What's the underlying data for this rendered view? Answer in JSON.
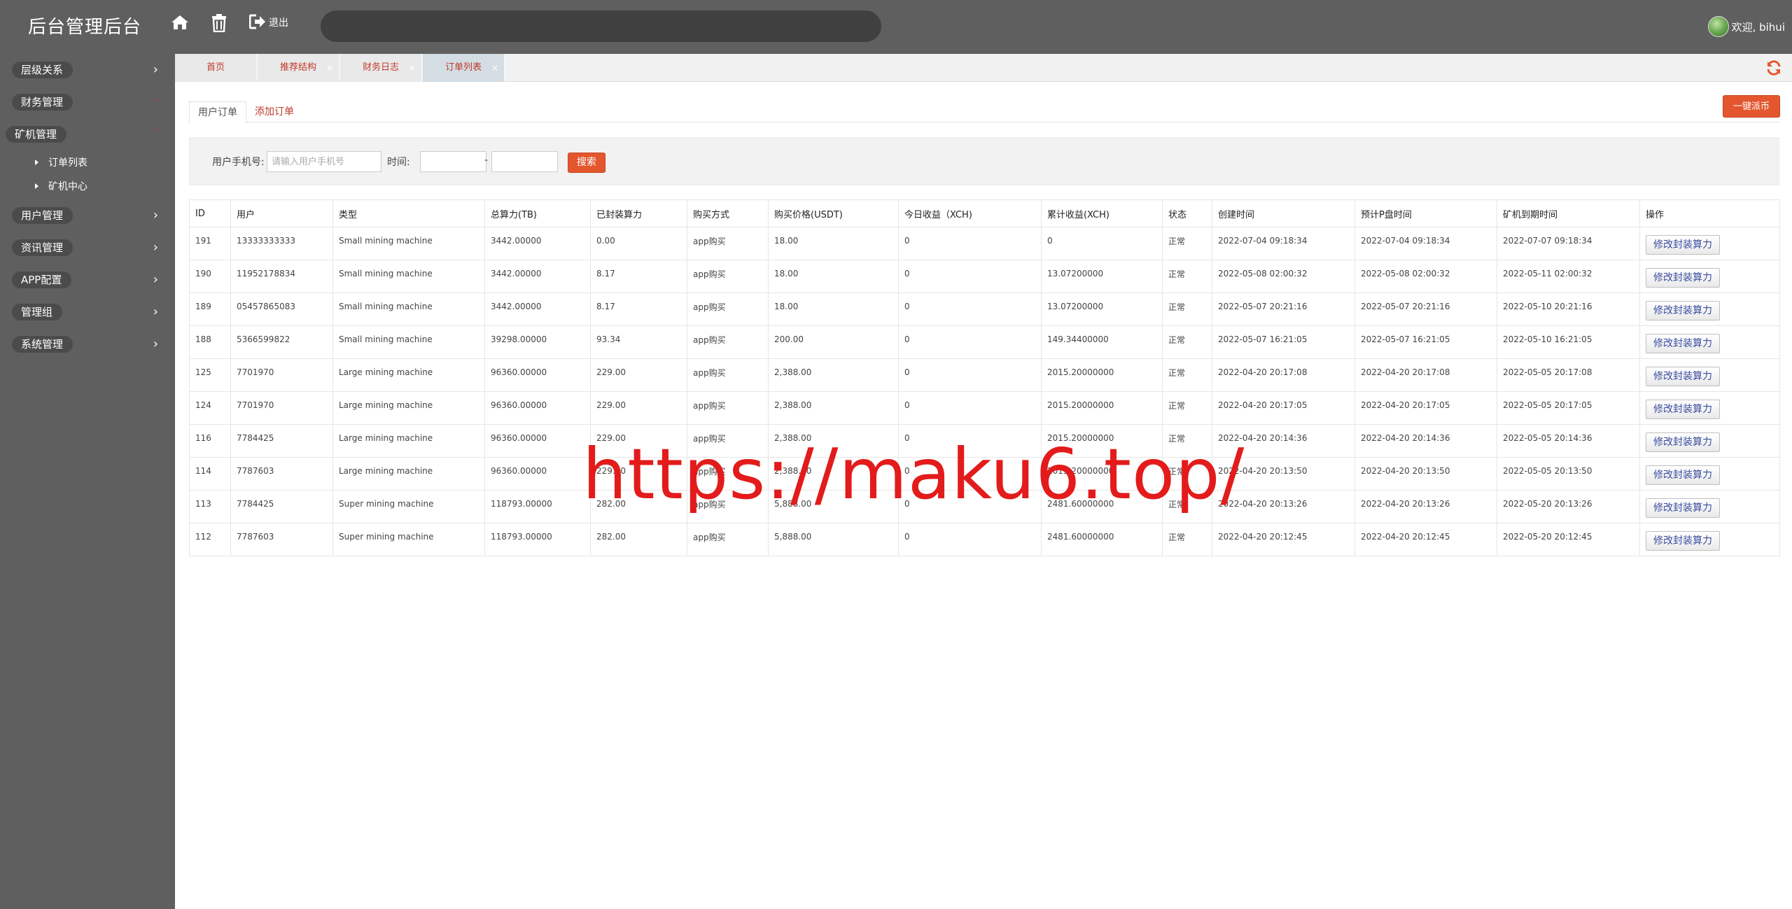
{
  "app": {
    "title": "后台管理后台"
  },
  "header": {
    "logout_label": "退出",
    "search_placeholder": "",
    "welcome": "欢迎, bihui"
  },
  "sidebar": {
    "items": [
      {
        "label": "层级关系"
      },
      {
        "label": "财务管理"
      },
      {
        "label": "矿机管理",
        "children": [
          {
            "label": "订单列表"
          },
          {
            "label": "矿机中心"
          }
        ]
      },
      {
        "label": "用户管理"
      },
      {
        "label": "资讯管理"
      },
      {
        "label": "APP配置"
      },
      {
        "label": "管理组"
      },
      {
        "label": "系统管理"
      }
    ]
  },
  "tabs": [
    {
      "label": "首页"
    },
    {
      "label": "推荐结构"
    },
    {
      "label": "财务日志"
    },
    {
      "label": "订单列表"
    }
  ],
  "subtabs": {
    "active": "用户订单",
    "link": "添加订单"
  },
  "onekey_button": "一键派币",
  "filter": {
    "phone_label": "用户手机号:",
    "phone_placeholder": "请输入用户手机号",
    "time_label": "时间:",
    "range_sep": "-",
    "search_button": "搜索"
  },
  "table": {
    "headers": [
      "ID",
      "用户",
      "类型",
      "总算力(TB)",
      "已封装算力",
      "购买方式",
      "购买价格(USDT)",
      "今日收益（XCH)",
      "累计收益(XCH)",
      "状态",
      "创建时间",
      "预计P盘时间",
      "矿机到期时间",
      "操作"
    ],
    "action_label": "修改封装算力",
    "rows": [
      [
        "191",
        "13333333333",
        "Small mining machine",
        "3442.00000",
        "0.00",
        "app购买",
        "18.00",
        "0",
        "0",
        "正常",
        "2022-07-04 09:18:34",
        "2022-07-04 09:18:34",
        "2022-07-07 09:18:34"
      ],
      [
        "190",
        "11952178834",
        "Small mining machine",
        "3442.00000",
        "8.17",
        "app购买",
        "18.00",
        "0",
        "13.07200000",
        "正常",
        "2022-05-08 02:00:32",
        "2022-05-08 02:00:32",
        "2022-05-11 02:00:32"
      ],
      [
        "189",
        "05457865083",
        "Small mining machine",
        "3442.00000",
        "8.17",
        "app购买",
        "18.00",
        "0",
        "13.07200000",
        "正常",
        "2022-05-07 20:21:16",
        "2022-05-07 20:21:16",
        "2022-05-10 20:21:16"
      ],
      [
        "188",
        "5366599822",
        "Small mining machine",
        "39298.00000",
        "93.34",
        "app购买",
        "200.00",
        "0",
        "149.34400000",
        "正常",
        "2022-05-07 16:21:05",
        "2022-05-07 16:21:05",
        "2022-05-10 16:21:05"
      ],
      [
        "125",
        "7701970",
        "Large mining machine",
        "96360.00000",
        "229.00",
        "app购买",
        "2,388.00",
        "0",
        "2015.20000000",
        "正常",
        "2022-04-20 20:17:08",
        "2022-04-20 20:17:08",
        "2022-05-05 20:17:08"
      ],
      [
        "124",
        "7701970",
        "Large mining machine",
        "96360.00000",
        "229.00",
        "app购买",
        "2,388.00",
        "0",
        "2015.20000000",
        "正常",
        "2022-04-20 20:17:05",
        "2022-04-20 20:17:05",
        "2022-05-05 20:17:05"
      ],
      [
        "116",
        "7784425",
        "Large mining machine",
        "96360.00000",
        "229.00",
        "app购买",
        "2,388.00",
        "0",
        "2015.20000000",
        "正常",
        "2022-04-20 20:14:36",
        "2022-04-20 20:14:36",
        "2022-05-05 20:14:36"
      ],
      [
        "114",
        "7787603",
        "Large mining machine",
        "96360.00000",
        "229.00",
        "app购买",
        "2,388.00",
        "0",
        "2015.20000000",
        "正常",
        "2022-04-20 20:13:50",
        "2022-04-20 20:13:50",
        "2022-05-05 20:13:50"
      ],
      [
        "113",
        "7784425",
        "Super mining machine",
        "118793.00000",
        "282.00",
        "app购买",
        "5,888.00",
        "0",
        "2481.60000000",
        "正常",
        "2022-04-20 20:13:26",
        "2022-04-20 20:13:26",
        "2022-05-20 20:13:26"
      ],
      [
        "112",
        "7787603",
        "Super mining machine",
        "118793.00000",
        "282.00",
        "app购买",
        "5,888.00",
        "0",
        "2481.60000000",
        "正常",
        "2022-04-20 20:12:45",
        "2022-04-20 20:12:45",
        "2022-05-20 20:12:45"
      ]
    ]
  },
  "watermark": "https://maku6.top/"
}
